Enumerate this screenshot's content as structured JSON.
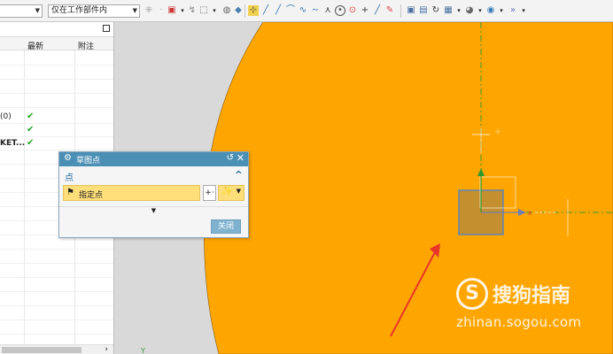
{
  "toolbar": {
    "filter_select": "",
    "scope_select": "仅在工作部件内"
  },
  "nav": {
    "columns": [
      "最新",
      "附注"
    ],
    "rows": [
      {
        "name": "",
        "check": ""
      },
      {
        "name": "",
        "check": ""
      },
      {
        "name": "",
        "check": ""
      },
      {
        "name": "",
        "check": ""
      },
      {
        "name": "(0)",
        "check": "✔"
      },
      {
        "name": "",
        "check": "✔"
      },
      {
        "name": "KET...",
        "check": "✔"
      }
    ]
  },
  "dialog": {
    "title": "草图点",
    "section": "点",
    "specify_point": "指定点",
    "close_button": "关闭"
  },
  "watermark": {
    "logo": "S",
    "brand": "搜狗指南",
    "url": "zhinan.sogou.com"
  },
  "colors": {
    "part_face": "#FFA500",
    "dialog_title": "#4b8fb5",
    "highlight_field": "#ffdf7a",
    "axis_green": "#3a9a3a",
    "arrow_red": "#e8352a"
  },
  "icons": [
    "filter-dropdown",
    "snap-point-icons",
    "sketch-curve-icons",
    "view-icons"
  ]
}
